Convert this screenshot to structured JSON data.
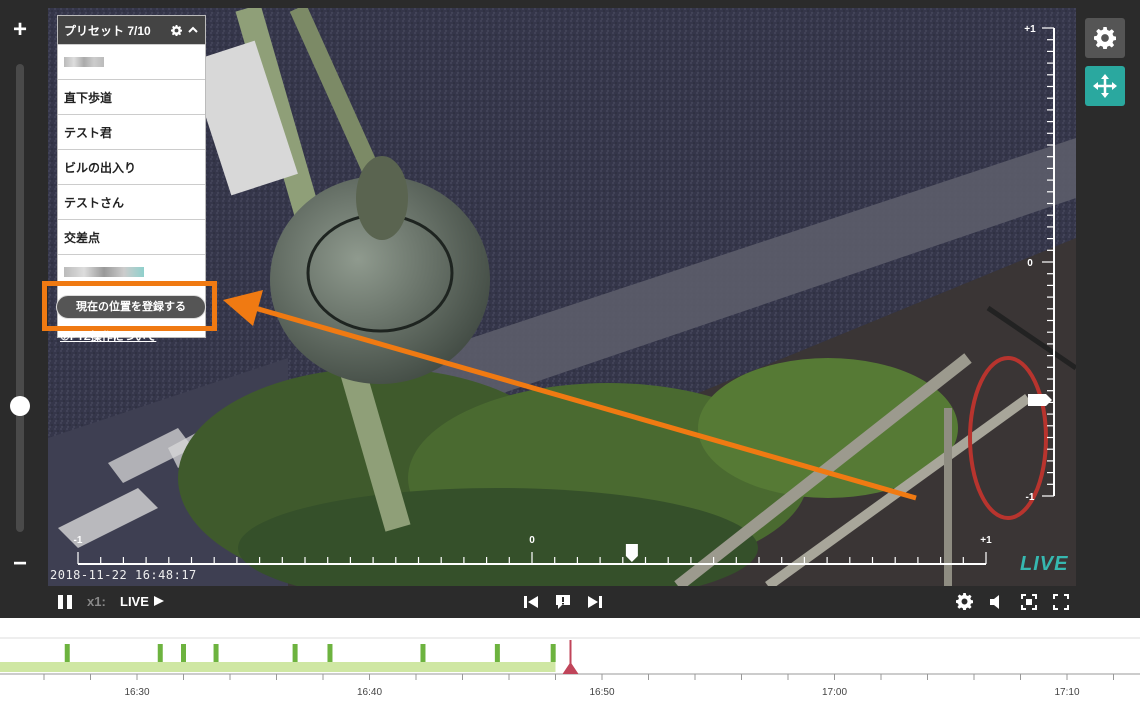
{
  "zoom": {
    "plus_label": "+",
    "minus_label": "−",
    "level": 0.27
  },
  "preset_panel": {
    "title": "プリセット 7/10",
    "items": [
      {
        "label": "",
        "blurred": true
      },
      {
        "label": "直下歩道"
      },
      {
        "label": "テスト君"
      },
      {
        "label": "ビルの出入り"
      },
      {
        "label": "テストさん"
      },
      {
        "label": "交差点"
      },
      {
        "label": "",
        "blurred": true
      }
    ],
    "register_button": "現在の位置を登録する",
    "ptz_help_link": "⑦PTZ操作について"
  },
  "video": {
    "timestamp": "2018-11-22  16:48:17",
    "live_badge": "LIVE"
  },
  "pan_scale": {
    "left_label": "-1",
    "center_label": "0",
    "right_label": "+1",
    "value": 0.22
  },
  "tilt_scale": {
    "top_label": "+1",
    "center_label": "0",
    "bottom_label": "-1",
    "value": -0.59
  },
  "controls": {
    "speed": "x1:",
    "live": "LIVE"
  },
  "timeline": {
    "ticks": [
      "16:30",
      "16:40",
      "16:50",
      "17:00",
      "17:10"
    ],
    "recorded_until": "16:48",
    "current_time": "16:48"
  },
  "colors": {
    "accent_teal": "#2aa89f",
    "annotation_orange": "#f07a12",
    "recorded_green": "#cfe7a3",
    "event_marker": "#6db33f",
    "playhead": "#c0455a"
  }
}
